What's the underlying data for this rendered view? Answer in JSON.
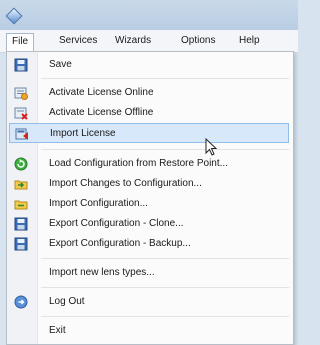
{
  "menubar": {
    "items": [
      "File",
      "Services",
      "Wizards",
      "Options",
      "Help"
    ]
  },
  "file_menu": {
    "save": "Save",
    "activate_online": "Activate License Online",
    "activate_offline": "Activate License Offline",
    "import_license": "Import License",
    "load_restore": "Load Configuration from Restore Point...",
    "import_changes": "Import Changes to Configuration...",
    "import_config": "Import Configuration...",
    "export_clone": "Export Configuration - Clone...",
    "export_backup": "Export Configuration - Backup...",
    "import_lens": "Import new lens types...",
    "log_out": "Log Out",
    "exit": "Exit"
  },
  "highlighted_item": "import_license",
  "colors": {
    "highlight_bg": "#d6e8f9",
    "highlight_border": "#92bde8",
    "titlebar": "#c9d9ea"
  }
}
